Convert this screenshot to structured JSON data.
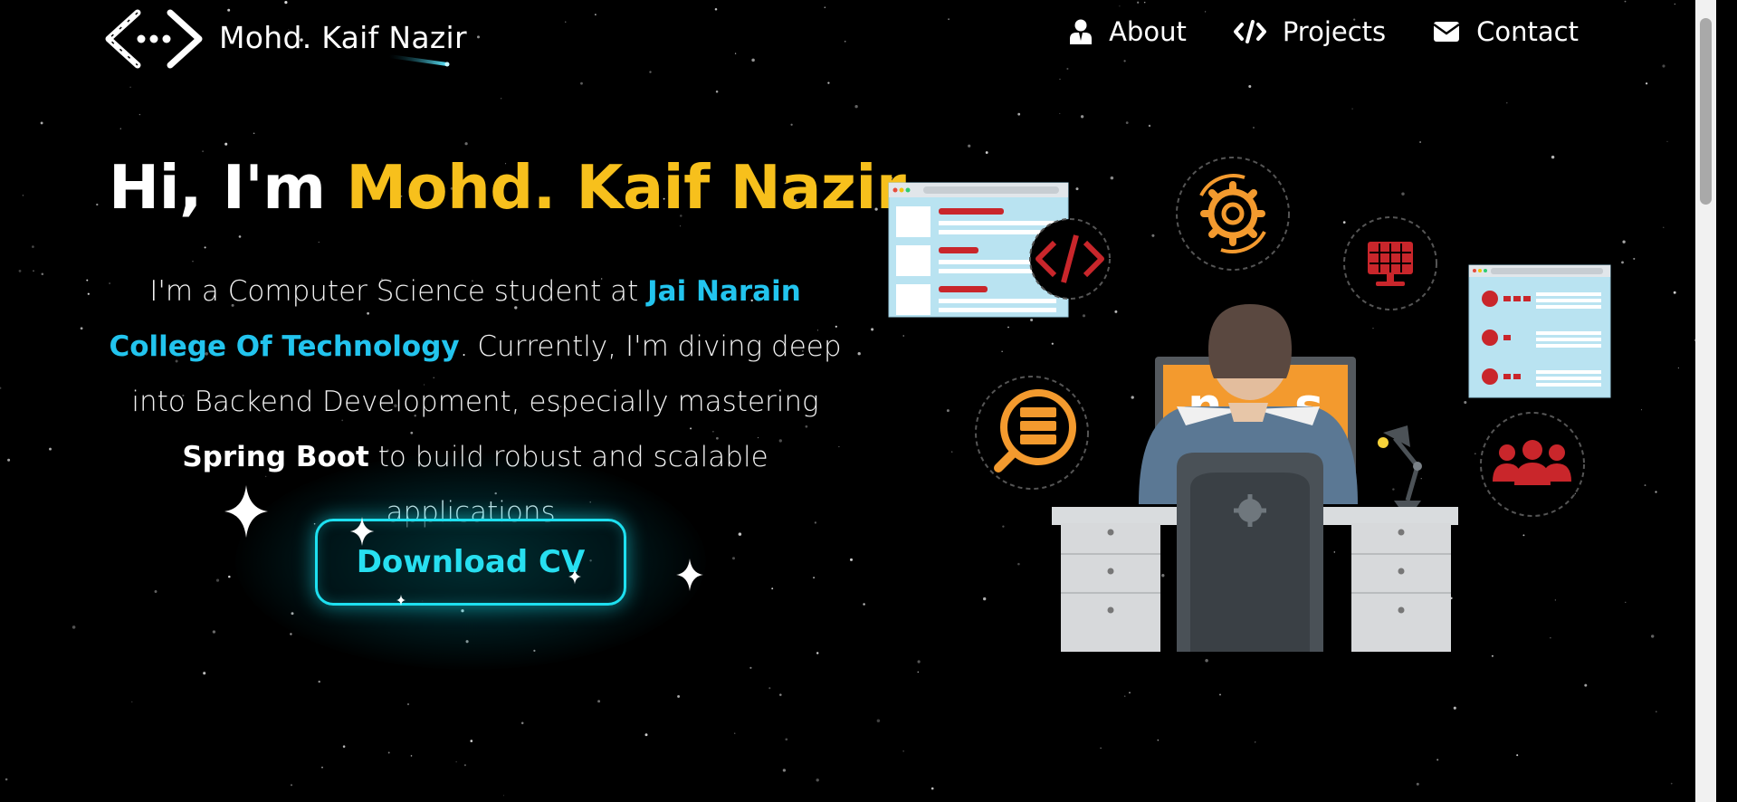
{
  "header": {
    "logo_name": "Mohd. Kaif Nazir",
    "logo_icon": "code-brackets-icon",
    "nav": [
      {
        "label": "About",
        "icon": "user-icon"
      },
      {
        "label": "Projects",
        "icon": "code-icon"
      },
      {
        "label": "Contact",
        "icon": "envelope-icon"
      }
    ]
  },
  "hero": {
    "greeting": "Hi, I'm ",
    "name": "Mohd. Kaif Nazir",
    "text_1": "I'm a Computer Science student at ",
    "college": "Jai Narain College Of Technology",
    "text_2": ". Currently, I'm diving deep into Backend Development, especially mastering ",
    "framework": "Spring Boot",
    "text_3": " to build robust and scalable applications.",
    "cta_label": "Download CV"
  },
  "colors": {
    "background": "#000000",
    "accent_yellow": "#f7c01c",
    "accent_cyan": "#22c4ee",
    "button_cyan": "#1ee0f0",
    "illustration_orange": "#f39a2e",
    "illustration_red": "#c9262b"
  }
}
